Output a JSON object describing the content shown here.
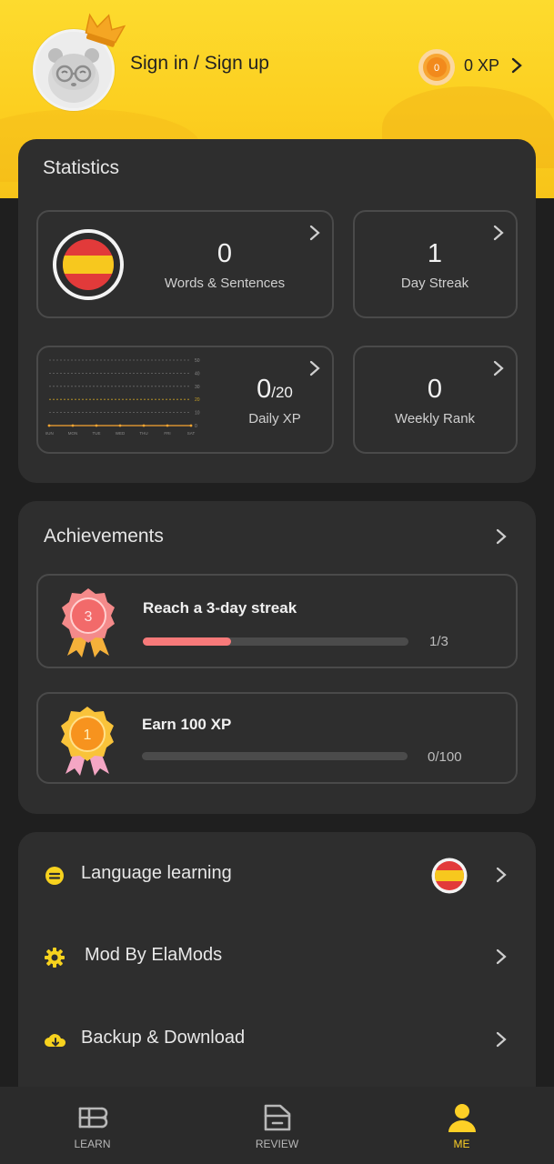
{
  "header": {
    "signin_label": "Sign in / Sign up",
    "xp_label": "0 XP",
    "coin_value": "0"
  },
  "statistics": {
    "title": "Statistics",
    "words": {
      "value": "0",
      "label": "Words & Sentences"
    },
    "streak": {
      "value": "1",
      "label": "Day Streak"
    },
    "daily_xp": {
      "value": "0",
      "goal": "/20",
      "label": "Daily XP",
      "chart_y_ticks": [
        "50",
        "40",
        "30",
        "20",
        "10",
        "0"
      ],
      "chart_days": [
        "SUN",
        "MON",
        "TUE",
        "WED",
        "THU",
        "FRI",
        "SAT"
      ],
      "chart_values": [
        0,
        0,
        0,
        0,
        0,
        0,
        0
      ]
    },
    "weekly_rank": {
      "value": "0",
      "label": "Weekly Rank"
    }
  },
  "achievements": {
    "title": "Achievements",
    "items": [
      {
        "badge": "3",
        "title": "Reach a 3-day streak",
        "progress_text": "1/3",
        "progress": 0.333,
        "color": "#f77a7a"
      },
      {
        "badge": "1",
        "title": "Earn 100 XP",
        "progress_text": "0/100",
        "progress": 0,
        "color": "#f7b731"
      }
    ]
  },
  "menu": {
    "items": [
      {
        "icon": "language-icon",
        "label": "Language learning"
      },
      {
        "icon": "gear-icon",
        "label": "Mod By ElaMods"
      },
      {
        "icon": "cloud-download-icon",
        "label": "Backup & Download"
      }
    ]
  },
  "nav": {
    "items": [
      {
        "icon": "learn-icon",
        "label": "LEARN",
        "active": false
      },
      {
        "icon": "review-icon",
        "label": "REVIEW",
        "active": false
      },
      {
        "icon": "me-icon",
        "label": "ME",
        "active": true
      }
    ]
  },
  "colors": {
    "accent": "#fdd026",
    "panel": "#2e2e2e",
    "background": "#1f1f1f",
    "progress_red": "#f77a7a"
  }
}
